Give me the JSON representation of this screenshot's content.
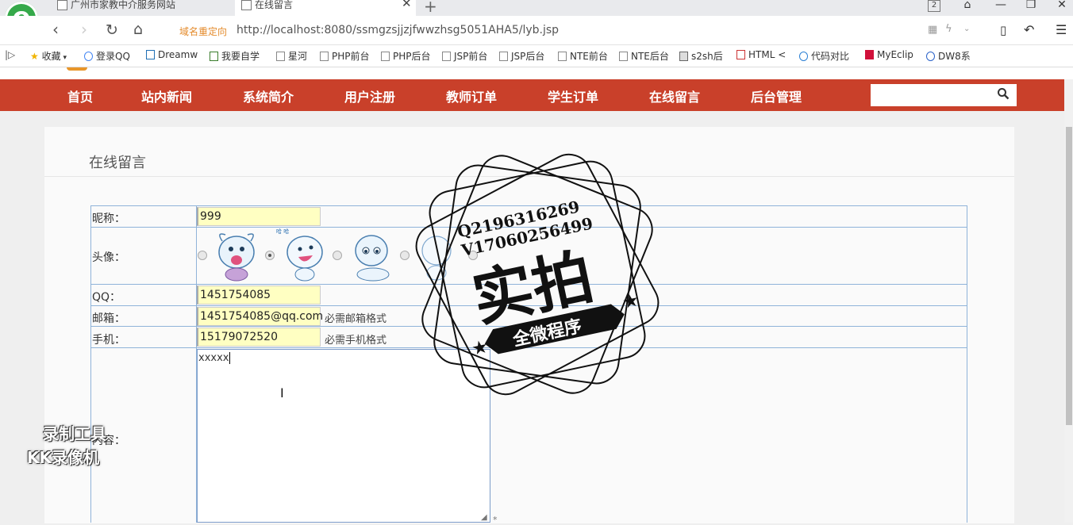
{
  "browser": {
    "tabs": [
      {
        "label": "广州市家教中介服务网站"
      },
      {
        "label": "在线留言"
      }
    ],
    "tab_count": "2",
    "redirect_label": "域名重定向",
    "url": "http://localhost:8080/ssmgzsjjzjfwwzhsg5051AHA5/lyb.jsp",
    "bookmarks": [
      {
        "label": "收藏"
      },
      {
        "label": "登录QQ"
      },
      {
        "label": "Dreamw"
      },
      {
        "label": "我要自学"
      },
      {
        "label": "星河"
      },
      {
        "label": "PHP前台"
      },
      {
        "label": "PHP后台"
      },
      {
        "label": "JSP前台"
      },
      {
        "label": "JSP后台"
      },
      {
        "label": "NTE前台"
      },
      {
        "label": "NTE后台"
      },
      {
        "label": "s2sh后"
      },
      {
        "label": "HTML <"
      },
      {
        "label": "代码对比"
      },
      {
        "label": "MyEclip"
      },
      {
        "label": "DW8系"
      }
    ]
  },
  "nav": {
    "items": [
      {
        "label": "首页"
      },
      {
        "label": "站内新闻"
      },
      {
        "label": "系统简介"
      },
      {
        "label": "用户注册"
      },
      {
        "label": "教师订单"
      },
      {
        "label": "学生订单"
      },
      {
        "label": "在线留言"
      },
      {
        "label": "后台管理"
      }
    ],
    "search_value": ""
  },
  "page": {
    "title": "在线留言",
    "form": {
      "nickname_label": "昵称：",
      "nickname_value": "999",
      "avatar_label": "头像：",
      "qq_label": "QQ：",
      "qq_value": "1451754085",
      "email_label": "邮箱：",
      "email_value": "1451754085@qq.com",
      "email_hint": "必需邮箱格式",
      "phone_label": "手机：",
      "phone_value": "15179072520",
      "phone_hint": "必需手机格式",
      "content_label": "内容：",
      "content_value": "xxxxx"
    }
  },
  "overlays": {
    "stamp_contact_1": "Q2196316269",
    "stamp_contact_2": "V17060256499",
    "stamp_title": "实拍",
    "stamp_banner": "全微程序",
    "recorder_line1": "录制工具",
    "recorder_line2": "KK录像机"
  },
  "colors": {
    "nav_bg": "#c9402a",
    "input_bg": "#ffffc2",
    "table_border": "#8fb3d9"
  }
}
